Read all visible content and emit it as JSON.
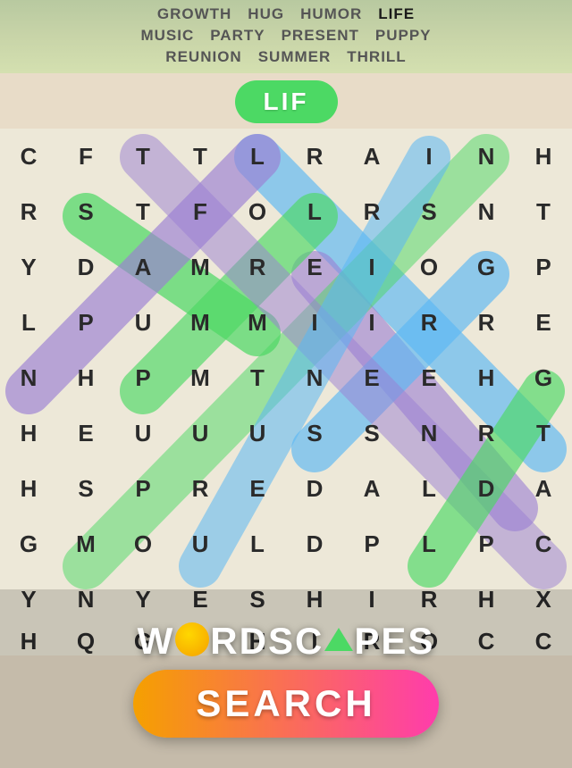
{
  "banner": {
    "rows": [
      [
        {
          "text": "GROWTH",
          "highlighted": false
        },
        {
          "text": "HUG",
          "highlighted": false
        },
        {
          "text": "HUMOR",
          "highlighted": false
        },
        {
          "text": "LIFE",
          "highlighted": true
        }
      ],
      [
        {
          "text": "MUSIC",
          "highlighted": false
        },
        {
          "text": "PARTY",
          "highlighted": false
        },
        {
          "text": "PRESENT",
          "highlighted": false
        },
        {
          "text": "PUPPY",
          "highlighted": false
        }
      ],
      [
        {
          "text": "REUNION",
          "highlighted": false
        },
        {
          "text": "SUMMER",
          "highlighted": false
        },
        {
          "text": "THRILL",
          "highlighted": false
        }
      ]
    ]
  },
  "current_word": "LIF",
  "grid": {
    "cols": 10,
    "rows": 9,
    "cells": [
      "C",
      "F",
      "T",
      "T",
      "L",
      "R",
      "A",
      "I",
      "N",
      "H",
      "R",
      "S",
      "T",
      "F",
      "O",
      "L",
      "R",
      "S",
      "N",
      "T",
      "Y",
      "D",
      "A",
      "M",
      "R",
      "E",
      "I",
      "O",
      "G",
      "P",
      "L",
      "P",
      "U",
      "M",
      "M",
      "I",
      "I",
      "R",
      "R",
      "E",
      "N",
      "H",
      "P",
      "M",
      "T",
      "N",
      "E",
      "E",
      "H",
      "G",
      "H",
      "E",
      "U",
      "U",
      "U",
      "S",
      "S",
      "N",
      "R",
      "T",
      "H",
      "S",
      "P",
      "R",
      "E",
      "D",
      "A",
      "L",
      "D",
      "A",
      "G",
      "M",
      "O",
      "U",
      "L",
      "D",
      "P",
      "L",
      "P",
      "C",
      "Y",
      "N",
      "Y",
      "E",
      "S",
      "H",
      "I",
      "R",
      "H",
      "X",
      "H",
      "Q",
      "G",
      "S",
      "H",
      "I",
      "R",
      "O",
      "C",
      "C"
    ]
  },
  "logo": {
    "title_parts": [
      "W",
      "O_CIRCLE",
      "RDSC",
      "A_TRIANGLE",
      "PES"
    ],
    "title_text": "WORDSCAPES",
    "search_label": "SEARCH"
  },
  "colors": {
    "green_highlight": "#4cd964",
    "purple_highlight": "#9b7fd4",
    "blue_highlight": "#5bb8f5",
    "orange_accent": "#f5a000",
    "pink_accent": "#ff3cac"
  }
}
